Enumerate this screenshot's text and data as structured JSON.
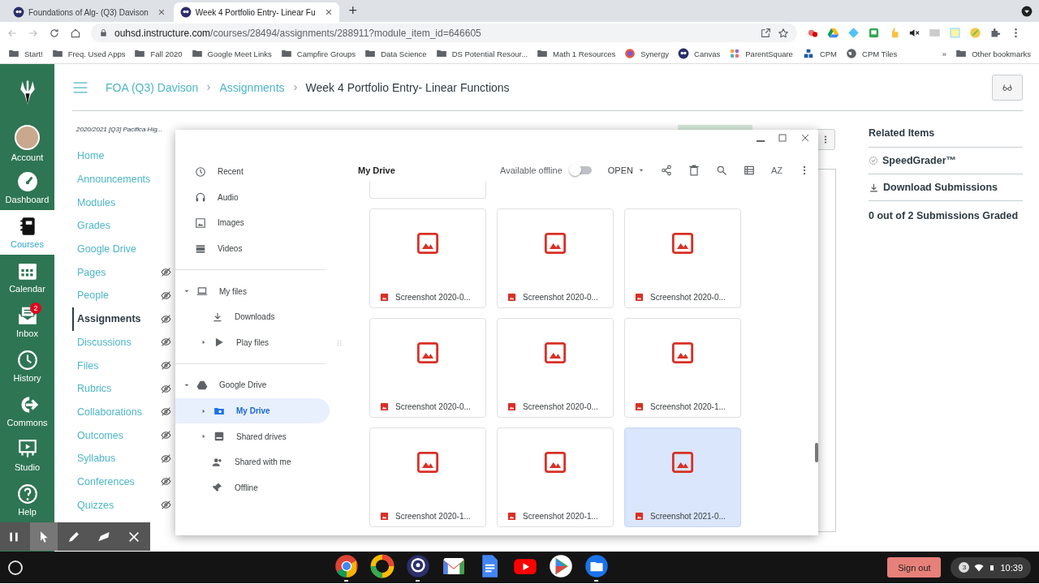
{
  "browser": {
    "tabs": [
      {
        "title": "Foundations of Alg- (Q3) Davison",
        "selected": false
      },
      {
        "title": "Week 4 Portfolio Entry- Linear Fu",
        "selected": true
      }
    ],
    "new_tab": "+",
    "url": {
      "host": "ouhsd.instructure.com",
      "path": "/courses/28494/assignments/288911?module_item_id=646605"
    },
    "bookmarks": [
      {
        "label": "Start!",
        "kind": "folder"
      },
      {
        "label": "Freq. Used Apps",
        "kind": "folder"
      },
      {
        "label": "Fall 2020",
        "kind": "folder"
      },
      {
        "label": "Google Meet Links",
        "kind": "folder"
      },
      {
        "label": "Campfire Groups",
        "kind": "folder"
      },
      {
        "label": "Data Science",
        "kind": "folder"
      },
      {
        "label": "DS Potential Resour...",
        "kind": "folder"
      },
      {
        "label": "Math 1 Resources",
        "kind": "folder"
      },
      {
        "label": "Synergy",
        "kind": "synergy"
      },
      {
        "label": "Canvas",
        "kind": "canvas"
      },
      {
        "label": "ParentSquare",
        "kind": "parentsquare"
      },
      {
        "label": "CPM",
        "kind": "cpm"
      },
      {
        "label": "CPM Tiles",
        "kind": "globe"
      }
    ],
    "overflow": "»",
    "other_bookmarks": "Other bookmarks"
  },
  "global_nav": [
    {
      "label": "Account",
      "selected": false
    },
    {
      "label": "Dashboard",
      "selected": false
    },
    {
      "label": "Courses",
      "selected": true
    },
    {
      "label": "Calendar",
      "selected": false
    },
    {
      "label": "Inbox",
      "selected": false,
      "badge": "2"
    },
    {
      "label": "History",
      "selected": false
    },
    {
      "label": "Commons",
      "selected": false
    },
    {
      "label": "Studio",
      "selected": false
    },
    {
      "label": "Help",
      "selected": false
    }
  ],
  "breadcrumbs": [
    "FOA (Q3) Davison",
    "Assignments",
    "Week 4 Portfolio Entry- Linear Functions"
  ],
  "course_nav": {
    "term": "2020/2021 [Q3] Pacifica Hig...",
    "items": [
      {
        "label": "Home",
        "hidden": false,
        "selected": false
      },
      {
        "label": "Announcements",
        "hidden": false,
        "selected": false
      },
      {
        "label": "Modules",
        "hidden": false,
        "selected": false
      },
      {
        "label": "Grades",
        "hidden": false,
        "selected": false
      },
      {
        "label": "Google Drive",
        "hidden": false,
        "selected": false
      },
      {
        "label": "Pages",
        "hidden": true,
        "selected": false
      },
      {
        "label": "People",
        "hidden": true,
        "selected": false
      },
      {
        "label": "Assignments",
        "hidden": true,
        "selected": true
      },
      {
        "label": "Discussions",
        "hidden": true,
        "selected": false
      },
      {
        "label": "Files",
        "hidden": true,
        "selected": false
      },
      {
        "label": "Rubrics",
        "hidden": true,
        "selected": false
      },
      {
        "label": "Collaborations",
        "hidden": true,
        "selected": false
      },
      {
        "label": "Outcomes",
        "hidden": true,
        "selected": false
      },
      {
        "label": "Syllabus",
        "hidden": true,
        "selected": false
      },
      {
        "label": "Conferences",
        "hidden": true,
        "selected": false
      },
      {
        "label": "Quizzes",
        "hidden": true,
        "selected": false
      }
    ]
  },
  "related": {
    "title": "Related Items",
    "links": [
      {
        "label": "SpeedGrader™",
        "kind": "speedgrader"
      },
      {
        "label": "Download Submissions",
        "kind": "download"
      }
    ],
    "graded": "0 out of 2 Submissions Graded"
  },
  "files_app": {
    "title": "My Drive",
    "offline_label": "Available offline",
    "offline": false,
    "open_label": "OPEN",
    "sort_label": "AZ",
    "sidebar": [
      {
        "label": "Recent",
        "kind": "recent",
        "selected": false
      },
      {
        "label": "Audio",
        "kind": "audio",
        "selected": false
      },
      {
        "label": "Images",
        "kind": "images",
        "selected": false
      },
      {
        "label": "Videos",
        "kind": "videos",
        "selected": false
      },
      {
        "label": "My files",
        "kind": "laptop",
        "selected": false,
        "expanded": true,
        "children": [
          {
            "label": "Downloads",
            "kind": "download",
            "selected": false
          },
          {
            "label": "Play files",
            "kind": "play",
            "selected": false,
            "expanded": false
          }
        ]
      },
      {
        "label": "Google Drive",
        "kind": "drive",
        "selected": false,
        "expanded": true,
        "children": [
          {
            "label": "My Drive",
            "kind": "folder",
            "selected": true,
            "expanded": false
          },
          {
            "label": "Shared drives",
            "kind": "shared-drive",
            "selected": false,
            "expanded": false
          },
          {
            "label": "Shared with me",
            "kind": "people",
            "selected": false
          },
          {
            "label": "Offline",
            "kind": "pin",
            "selected": false
          }
        ]
      }
    ],
    "files": [
      {
        "name": "Screenshot 2020-0...",
        "selected": false
      },
      {
        "name": "Screenshot 2020-0...",
        "selected": false
      },
      {
        "name": "Screenshot 2020-0...",
        "selected": false
      },
      {
        "name": "Screenshot 2020-0...",
        "selected": false
      },
      {
        "name": "Screenshot 2020-0...",
        "selected": false
      },
      {
        "name": "Screenshot 2020-1...",
        "selected": false
      },
      {
        "name": "Screenshot 2020-1...",
        "selected": false
      },
      {
        "name": "Screenshot 2020-1...",
        "selected": false
      },
      {
        "name": "Screenshot 2021-0...",
        "selected": true
      }
    ]
  },
  "annotation_tools": [
    {
      "kind": "pause",
      "selected": false
    },
    {
      "kind": "pointer",
      "selected": true
    },
    {
      "kind": "pen",
      "selected": false
    },
    {
      "kind": "highlighter",
      "selected": false
    },
    {
      "kind": "close",
      "selected": false
    }
  ],
  "shelf": {
    "apps": [
      {
        "kind": "chrome",
        "open": true
      },
      {
        "kind": "photos",
        "open": false
      },
      {
        "kind": "canvas",
        "open": true
      },
      {
        "kind": "gmail",
        "open": false
      },
      {
        "kind": "docs",
        "open": false
      },
      {
        "kind": "youtube",
        "open": false
      },
      {
        "kind": "play",
        "open": false
      },
      {
        "kind": "files",
        "open": true
      }
    ],
    "sign_out": "Sign out",
    "notifications": "3",
    "time": "10:39"
  }
}
